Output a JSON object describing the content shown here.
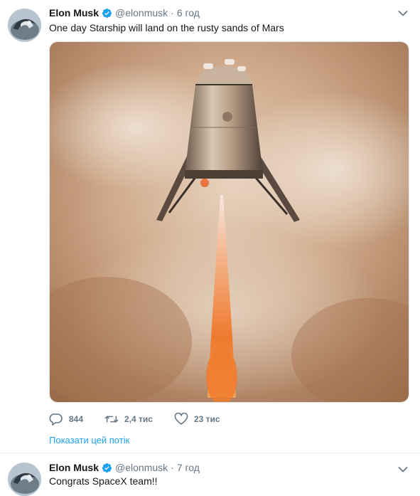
{
  "tweets": [
    {
      "author_name": "Elon Musk",
      "handle": "@elonmusk",
      "separator": "·",
      "time": "6 год",
      "text": "One day Starship will land on the rusty sands of Mars",
      "actions": {
        "replies": "844",
        "retweets": "2,4 тис",
        "likes": "23 тис"
      },
      "thread_link": "Показати цей потік"
    },
    {
      "author_name": "Elon Musk",
      "handle": "@elonmusk",
      "separator": "·",
      "time": "7 год",
      "text": "Congrats SpaceX team!!"
    }
  ],
  "colors": {
    "accent": "#1da1f2",
    "muted": "#657786",
    "text": "#14171a"
  },
  "icons": {
    "verified": "verified-badge-icon",
    "reply": "reply-bubble-icon",
    "retweet": "retweet-arrows-icon",
    "like": "heart-outline-icon",
    "menu": "chevron-down-icon"
  }
}
